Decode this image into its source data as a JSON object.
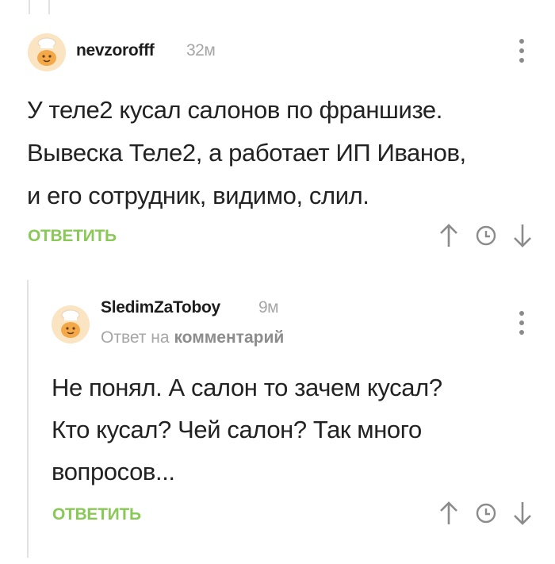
{
  "comments": [
    {
      "username": "nevzorofff",
      "time": "32м",
      "body_lines": [
        "У теле2 кусал салонов по франшизе.",
        "Вывеска Теле2, а работает ИП Иванов,",
        "и его сотрудник, видимо, слил."
      ],
      "reply_label": "ОТВЕТИТЬ"
    },
    {
      "username": "SledimZaToboy",
      "time": "9м",
      "reply_prefix": "Ответ на",
      "reply_link": "комментарий",
      "body_lines": [
        "Не понял. А салон то зачем кусал?",
        "Кто кусал? Чей салон? Так много",
        "вопросов..."
      ],
      "reply_label": "ОТВЕТИТЬ"
    }
  ],
  "icons": {
    "menu": "vertical-dots-icon",
    "upvote": "arrow-up-icon",
    "save": "clock-icon",
    "downvote": "arrow-down-icon"
  },
  "colors": {
    "accent_green": "#8ac858",
    "muted_gray": "#a6a6a6",
    "thread_line": "#e2e2e2",
    "avatar_bg": "#fbe4c2"
  }
}
